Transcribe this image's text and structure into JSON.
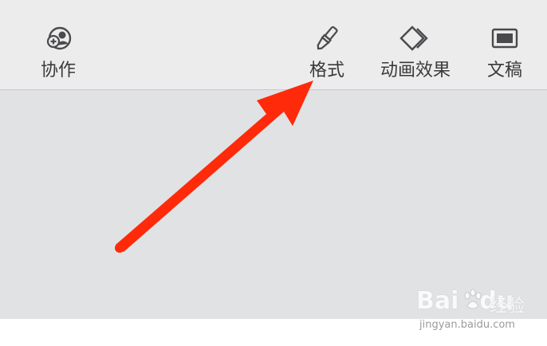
{
  "toolbar": {
    "collaborate": {
      "label": "协作",
      "icon": "person-add-icon"
    },
    "format": {
      "label": "格式",
      "icon": "paintbrush-icon"
    },
    "animate": {
      "label": "动画效果",
      "icon": "diamond-layers-icon"
    },
    "document": {
      "label": "文稿",
      "icon": "document-panel-icon"
    }
  },
  "annotation": {
    "color": "#ff2a0a",
    "icon": "red-arrow-icon"
  },
  "watermark": {
    "logo": "Bai",
    "logo_tail": "du",
    "cn": "经验",
    "url": "jingyan.baidu.com"
  },
  "colors": {
    "toolbar_bg": "#ececed",
    "content_bg": "#e1e2e4",
    "icon_gray": "#4a4a4c"
  }
}
